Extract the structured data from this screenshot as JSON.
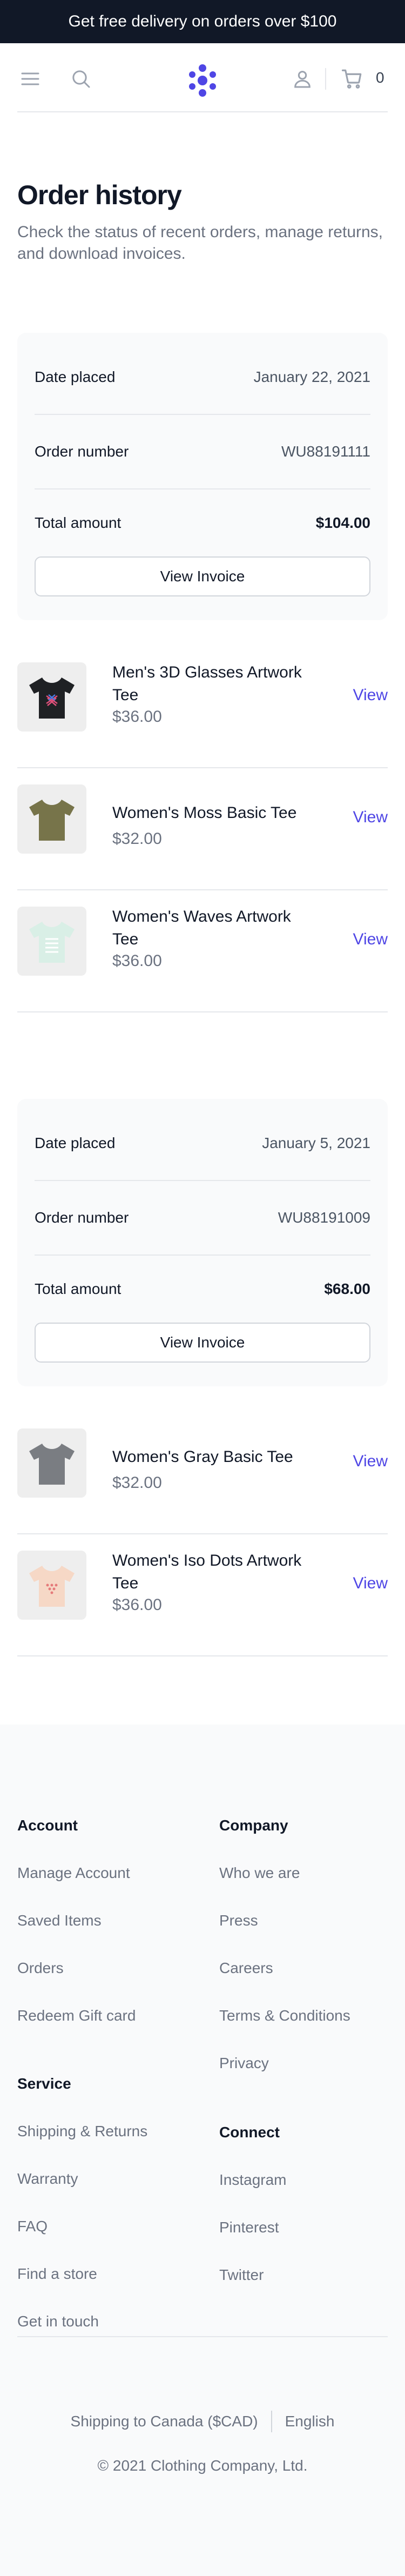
{
  "banner": {
    "text": "Get free delivery on orders over $100"
  },
  "header": {
    "cart_count": "0",
    "accent_color": "#4f46e5"
  },
  "page": {
    "title": "Order history",
    "description": "Check the status of recent orders, manage returns, and download invoices."
  },
  "labels": {
    "date_placed": "Date placed",
    "order_number": "Order number",
    "total_amount": "Total amount",
    "view_invoice": "View Invoice",
    "view": "View"
  },
  "orders": [
    {
      "date": "January 22, 2021",
      "number": "WU88191111",
      "total": "$104.00",
      "items": [
        {
          "name": "Men's 3D Glasses Artwork Tee",
          "price": "$36.00",
          "icon": "black-tee-icon"
        },
        {
          "name": "Women's Moss Basic Tee",
          "price": "$32.00",
          "icon": "olive-tee-icon"
        },
        {
          "name": "Women's Waves Artwork Tee",
          "price": "$36.00",
          "icon": "mint-tee-icon"
        }
      ]
    },
    {
      "date": "January 5, 2021",
      "number": "WU88191009",
      "total": "$68.00",
      "items": [
        {
          "name": "Women's Gray Basic Tee",
          "price": "$32.00",
          "icon": "gray-tee-icon"
        },
        {
          "name": "Women's Iso Dots Artwork Tee",
          "price": "$36.00",
          "icon": "peach-tee-icon"
        }
      ]
    }
  ],
  "footer": {
    "account": {
      "title": "Account",
      "links": [
        "Manage Account",
        "Saved Items",
        "Orders",
        "Redeem Gift card"
      ]
    },
    "service": {
      "title": "Service",
      "links": [
        "Shipping & Returns",
        "Warranty",
        "FAQ",
        "Find a store",
        "Get in touch"
      ]
    },
    "company": {
      "title": "Company",
      "links": [
        "Who we are",
        "Press",
        "Careers",
        "Terms & Conditions",
        "Privacy"
      ]
    },
    "connect": {
      "title": "Connect",
      "links": [
        "Instagram",
        "Pinterest",
        "Twitter"
      ]
    },
    "shipping": "Shipping to Canada ($CAD)",
    "language": "English",
    "copyright": "© 2021 Clothing Company, Ltd."
  }
}
